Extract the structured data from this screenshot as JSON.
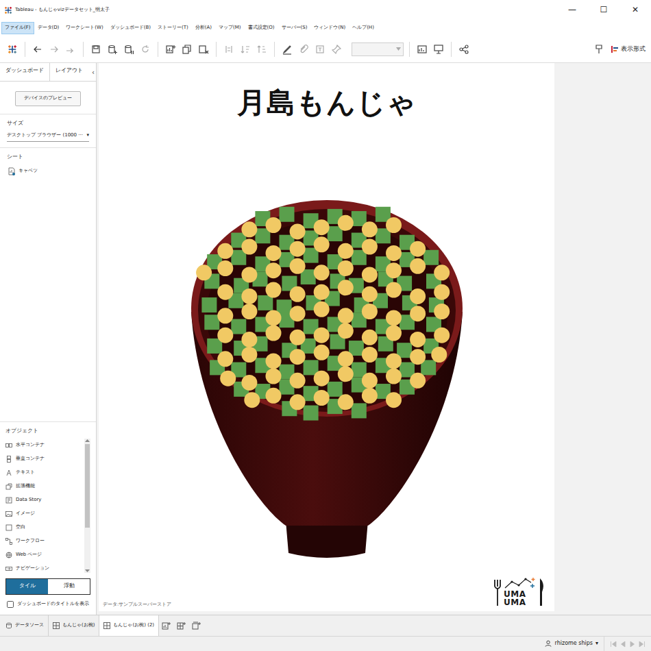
{
  "window": {
    "title": "Tableau - もんじゃvizデータセット_明太子",
    "controls": [
      "—",
      "☐",
      "✕"
    ]
  },
  "menu": [
    {
      "label": "ファイル(F)",
      "selected": true
    },
    {
      "label": "データ(D)",
      "selected": false
    },
    {
      "label": "ワークシート(W)",
      "selected": false
    },
    {
      "label": "ダッシュボード(B)",
      "selected": false
    },
    {
      "label": "ストーリー(T)",
      "selected": false
    },
    {
      "label": "分析(A)",
      "selected": false
    },
    {
      "label": "マップ(M)",
      "selected": false
    },
    {
      "label": "書式設定(O)",
      "selected": false
    },
    {
      "label": "サーバー(S)",
      "selected": false
    },
    {
      "label": "ウィンドウ(N)",
      "selected": false
    },
    {
      "label": "ヘルプ(H)",
      "selected": false
    }
  ],
  "toolbar": {
    "right_label": "表示形式"
  },
  "left_panel": {
    "tabs": [
      {
        "label": "ダッシュボード",
        "selected": true
      },
      {
        "label": "レイアウト",
        "selected": false
      }
    ],
    "collapse": "‹",
    "preview_button": "デバイスのプレビュー",
    "size": {
      "heading": "サイズ",
      "value": "デスクトップ ブラウザー (1000 ···",
      "arrow": "▾"
    },
    "sheets": {
      "heading": "シート",
      "items": [
        "キャベツ"
      ]
    },
    "objects": {
      "heading": "オブジェクト",
      "items": [
        "水平コンテナ",
        "垂直コンテナ",
        "テキスト",
        "拡張機能",
        "Data Story",
        "イメージ",
        "空白",
        "ワークフロー",
        "Web ページ",
        "ナビゲーション"
      ]
    },
    "layout_mode": [
      {
        "label": "タイル",
        "selected": true
      },
      {
        "label": "浮動",
        "selected": false
      }
    ],
    "show_title": {
      "label": "ダッシュボードのタイトルを表示",
      "checked": false
    }
  },
  "dashboard": {
    "title": "月島もんじゃ",
    "source": "データ:サンプルスーパーストア",
    "logo": [
      "UMA",
      "UMA"
    ],
    "chart": {
      "series": [
        {
          "kind": "square",
          "color": "#5a9f4c",
          "points": [
            [
              26,
              7
            ],
            [
              35,
              5
            ],
            [
              44,
              8
            ],
            [
              53,
              6
            ],
            [
              62,
              7
            ],
            [
              71,
              5
            ],
            [
              17,
              17
            ],
            [
              26,
              15
            ],
            [
              35,
              18
            ],
            [
              44,
              16
            ],
            [
              53,
              14
            ],
            [
              62,
              17
            ],
            [
              71,
              15
            ],
            [
              80,
              18
            ],
            [
              8,
              27
            ],
            [
              17,
              25
            ],
            [
              26,
              28
            ],
            [
              35,
              26
            ],
            [
              44,
              24
            ],
            [
              53,
              27
            ],
            [
              62,
              25
            ],
            [
              71,
              28
            ],
            [
              80,
              26
            ],
            [
              89,
              25
            ],
            [
              7,
              36
            ],
            [
              18,
              38
            ],
            [
              25,
              35
            ],
            [
              36,
              37
            ],
            [
              43,
              34
            ],
            [
              54,
              36
            ],
            [
              61,
              38
            ],
            [
              72,
              35
            ],
            [
              79,
              37
            ],
            [
              90,
              36
            ],
            [
              6,
              47
            ],
            [
              16,
              45
            ],
            [
              27,
              46
            ],
            [
              34,
              48
            ],
            [
              45,
              46
            ],
            [
              52,
              44
            ],
            [
              63,
              47
            ],
            [
              70,
              45
            ],
            [
              81,
              46
            ],
            [
              91,
              47
            ],
            [
              7,
              55
            ],
            [
              17,
              57
            ],
            [
              26,
              56
            ],
            [
              35,
              54
            ],
            [
              44,
              57
            ],
            [
              53,
              56
            ],
            [
              62,
              54
            ],
            [
              71,
              57
            ],
            [
              80,
              55
            ],
            [
              90,
              56
            ],
            [
              8,
              66
            ],
            [
              18,
              67
            ],
            [
              25,
              65
            ],
            [
              36,
              68
            ],
            [
              43,
              66
            ],
            [
              54,
              64
            ],
            [
              61,
              67
            ],
            [
              72,
              65
            ],
            [
              79,
              68
            ],
            [
              89,
              66
            ],
            [
              9,
              76
            ],
            [
              17,
              77
            ],
            [
              26,
              75
            ],
            [
              35,
              78
            ],
            [
              44,
              76
            ],
            [
              53,
              74
            ],
            [
              62,
              77
            ],
            [
              71,
              75
            ],
            [
              80,
              77
            ],
            [
              88,
              76
            ],
            [
              18,
              86
            ],
            [
              26,
              87
            ],
            [
              35,
              85
            ],
            [
              44,
              88
            ],
            [
              53,
              86
            ],
            [
              62,
              84
            ],
            [
              71,
              87
            ],
            [
              80,
              85
            ],
            [
              36,
              95
            ],
            [
              44,
              97
            ],
            [
              53,
              94
            ],
            [
              62,
              96
            ]
          ]
        },
        {
          "kind": "circle",
          "color": "#f1c964",
          "points": [
            [
              21,
              12
            ],
            [
              30,
              10
            ],
            [
              39,
              13
            ],
            [
              48,
              11
            ],
            [
              57,
              9
            ],
            [
              66,
              12
            ],
            [
              75,
              10
            ],
            [
              12,
              22
            ],
            [
              21,
              20
            ],
            [
              30,
              23
            ],
            [
              39,
              21
            ],
            [
              48,
              19
            ],
            [
              57,
              22
            ],
            [
              66,
              20
            ],
            [
              75,
              23
            ],
            [
              84,
              21
            ],
            [
              4,
              32
            ],
            [
              12,
              30
            ],
            [
              21,
              33
            ],
            [
              30,
              31
            ],
            [
              39,
              29
            ],
            [
              48,
              32
            ],
            [
              57,
              30
            ],
            [
              66,
              33
            ],
            [
              75,
              31
            ],
            [
              84,
              29
            ],
            [
              93,
              32
            ],
            [
              12,
              41
            ],
            [
              21,
              43
            ],
            [
              30,
              40
            ],
            [
              39,
              42
            ],
            [
              48,
              41
            ],
            [
              57,
              39
            ],
            [
              66,
              42
            ],
            [
              75,
              40
            ],
            [
              84,
              43
            ],
            [
              93,
              41
            ],
            [
              12,
              52
            ],
            [
              21,
              50
            ],
            [
              30,
              53
            ],
            [
              39,
              51
            ],
            [
              48,
              49
            ],
            [
              57,
              52
            ],
            [
              66,
              50
            ],
            [
              75,
              53
            ],
            [
              84,
              51
            ],
            [
              93,
              50
            ],
            [
              12,
              61
            ],
            [
              21,
              63
            ],
            [
              30,
              60
            ],
            [
              39,
              62
            ],
            [
              48,
              61
            ],
            [
              57,
              59
            ],
            [
              66,
              62
            ],
            [
              75,
              60
            ],
            [
              84,
              63
            ],
            [
              93,
              61
            ],
            [
              12,
              72
            ],
            [
              21,
              70
            ],
            [
              30,
              73
            ],
            [
              39,
              71
            ],
            [
              48,
              69
            ],
            [
              57,
              72
            ],
            [
              66,
              70
            ],
            [
              75,
              73
            ],
            [
              84,
              71
            ],
            [
              92,
              70
            ],
            [
              13,
              81
            ],
            [
              21,
              83
            ],
            [
              30,
              80
            ],
            [
              39,
              82
            ],
            [
              48,
              81
            ],
            [
              57,
              79
            ],
            [
              66,
              82
            ],
            [
              75,
              80
            ],
            [
              84,
              82
            ],
            [
              22,
              91
            ],
            [
              30,
              89
            ],
            [
              39,
              92
            ],
            [
              48,
              90
            ],
            [
              57,
              92
            ],
            [
              66,
              89
            ],
            [
              75,
              91
            ]
          ]
        }
      ]
    }
  },
  "sheet_tabs": [
    {
      "label": "データソース",
      "selected": false,
      "kind": "datasource"
    },
    {
      "label": "もんじゃ(お椀)",
      "selected": false,
      "kind": "dashboard"
    },
    {
      "label": "もんじゃ(お椀) (2)",
      "selected": true,
      "kind": "dashboard"
    }
  ],
  "status_bar": {
    "user": "rhizome ships",
    "arrow": "▾"
  }
}
